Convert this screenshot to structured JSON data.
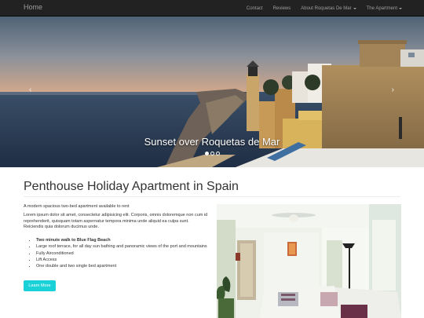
{
  "navbar": {
    "brand": "Home",
    "items": [
      {
        "label": "Contact",
        "dropdown": false
      },
      {
        "label": "Reviews",
        "dropdown": false
      },
      {
        "label": "About Roquetas De Mar",
        "dropdown": true
      },
      {
        "label": "The Apartment",
        "dropdown": true
      }
    ]
  },
  "carousel": {
    "caption": "Sunset over Roquetas de Mar",
    "prev_icon": "chevron-left-icon",
    "next_icon": "chevron-right-icon",
    "prev_glyph": "‹",
    "next_glyph": "›",
    "slide_count": 3,
    "active_slide": 1
  },
  "main": {
    "title": "Penthouse Holiday Apartment in Spain",
    "lead": "A modern spacious two-bed apartment available to rent",
    "body": "Lorem ipsum dolor sit amet, consectetur adipisicing elit. Corporis, omnis doloremque non cum id reprehenderit, quisquam totam aspernatur tempora minima unde aliquid ea culpa sunt. Reiciendis quia dolorum ducimus unde.",
    "features": [
      "Two minute walk to Blue Flag Beach",
      "Large roof terrace, for all day sun bathing and panoramic views of the port and mountains",
      "Fully Airconditioned",
      "Lift Access",
      "One double and two single bed apartment"
    ],
    "button_label": "Learn More"
  },
  "colors": {
    "navbar_bg": "#222222",
    "nav_text": "#9d9d9d",
    "button_bg": "#1ad1d8"
  }
}
